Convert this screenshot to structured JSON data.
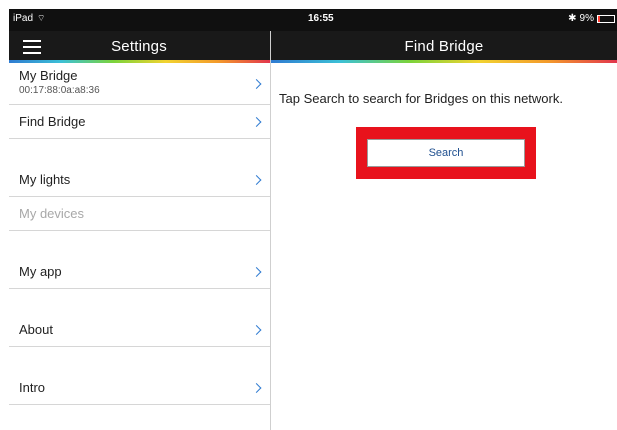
{
  "status_bar": {
    "device": "iPad",
    "time": "16:55",
    "bluetooth": "✱",
    "battery_percent": "9%",
    "battery_level": 0.09
  },
  "left": {
    "title": "Settings",
    "items": [
      {
        "label": "My Bridge",
        "sub": "00:17:88:0a:a8:36"
      },
      {
        "label": "Find Bridge"
      },
      {
        "label": "My lights"
      },
      {
        "label": "My devices"
      },
      {
        "label": "My app"
      },
      {
        "label": "About"
      },
      {
        "label": "Intro"
      }
    ]
  },
  "right": {
    "title": "Find Bridge",
    "instruction": "Tap Search to search for Bridges on this network.",
    "search_button": "Search"
  },
  "colors": {
    "accent_blue": "#2f7bd1",
    "highlight_red": "#e8121c",
    "nav_bg": "#191919"
  }
}
